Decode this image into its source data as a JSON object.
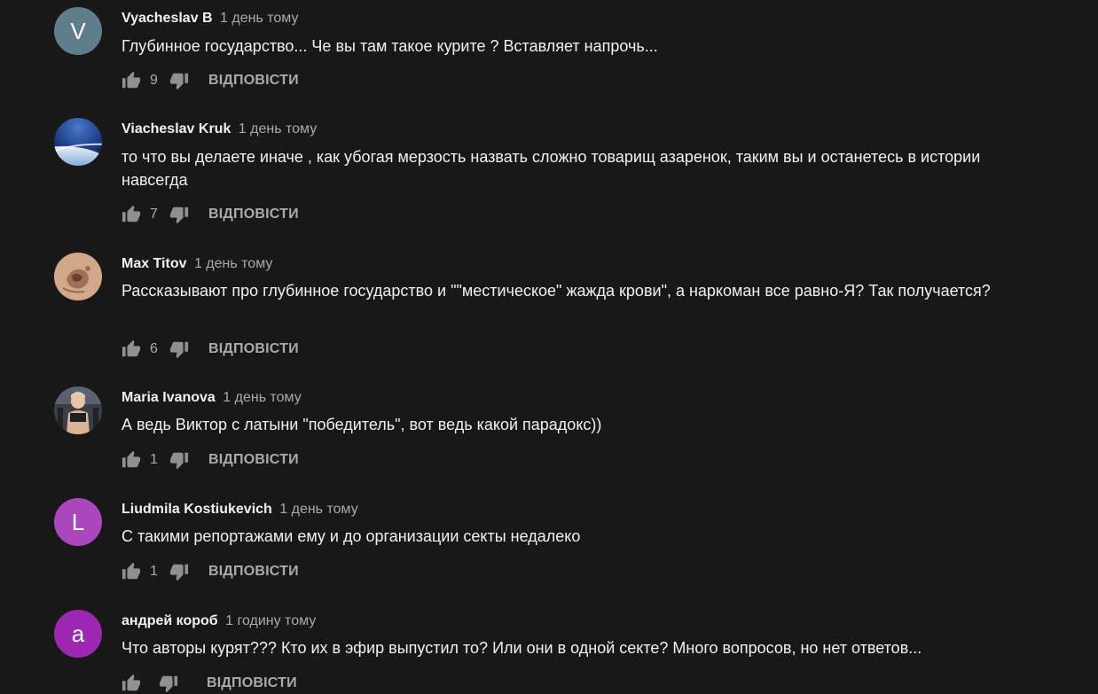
{
  "comments": [
    {
      "author": "Vyacheslav B",
      "time": "1 день тому",
      "text": "Глубинное государство... Че вы там такое курите ? Вставляет напрочь...",
      "likes": "9",
      "reply": "ВІДПОВІСТИ",
      "avatar": {
        "initial": "V",
        "color": "#607d8b"
      }
    },
    {
      "author": "Viacheslav Kruk",
      "time": "1 день тому",
      "text": "то что вы делаете иначе , как убогая мерзость назвать сложно товарищ азаренок, таким вы и останетесь в истории навсегда",
      "likes": "7",
      "reply": "ВІДПОВІСТИ",
      "avatar": {
        "image": "earth-from-space-photo"
      }
    },
    {
      "author": "Max Titov",
      "time": "1 день тому",
      "text": "Рассказывают про глубинное государство и \"\"местическое\" жажда крови\", а наркоман все равно-Я? Так получается?",
      "likes": "6",
      "reply": "ВІДПОВІСТИ",
      "avatar": {
        "image": "tattoo-photo"
      }
    },
    {
      "author": "Maria Ivanova",
      "time": "1 день тому",
      "text": "А ведь Виктор с латыни \"победитель\", вот ведь какой парадокс))",
      "likes": "1",
      "reply": "ВІДПОВІСТИ",
      "avatar": {
        "image": "person-gym-photo"
      }
    },
    {
      "author": "Liudmila Kostiukevich",
      "time": "1 день тому",
      "text": "С такими репортажами ему и до организации секты недалеко",
      "likes": "1",
      "reply": "ВІДПОВІСТИ",
      "avatar": {
        "initial": "L",
        "color": "#ab47bc"
      }
    },
    {
      "author": "андрей короб",
      "time": "1 годину тому",
      "text": "Что авторы курят??? Кто их в эфир выпустил то? Или они в одной секте? Много вопросов, но нет ответов...",
      "likes": "",
      "reply": "ВІДПОВІСТИ",
      "avatar": {
        "initial": "a",
        "color": "#9c27b0"
      }
    }
  ],
  "icons": {
    "like": "thumb-up-icon",
    "dislike": "thumb-down-icon"
  }
}
